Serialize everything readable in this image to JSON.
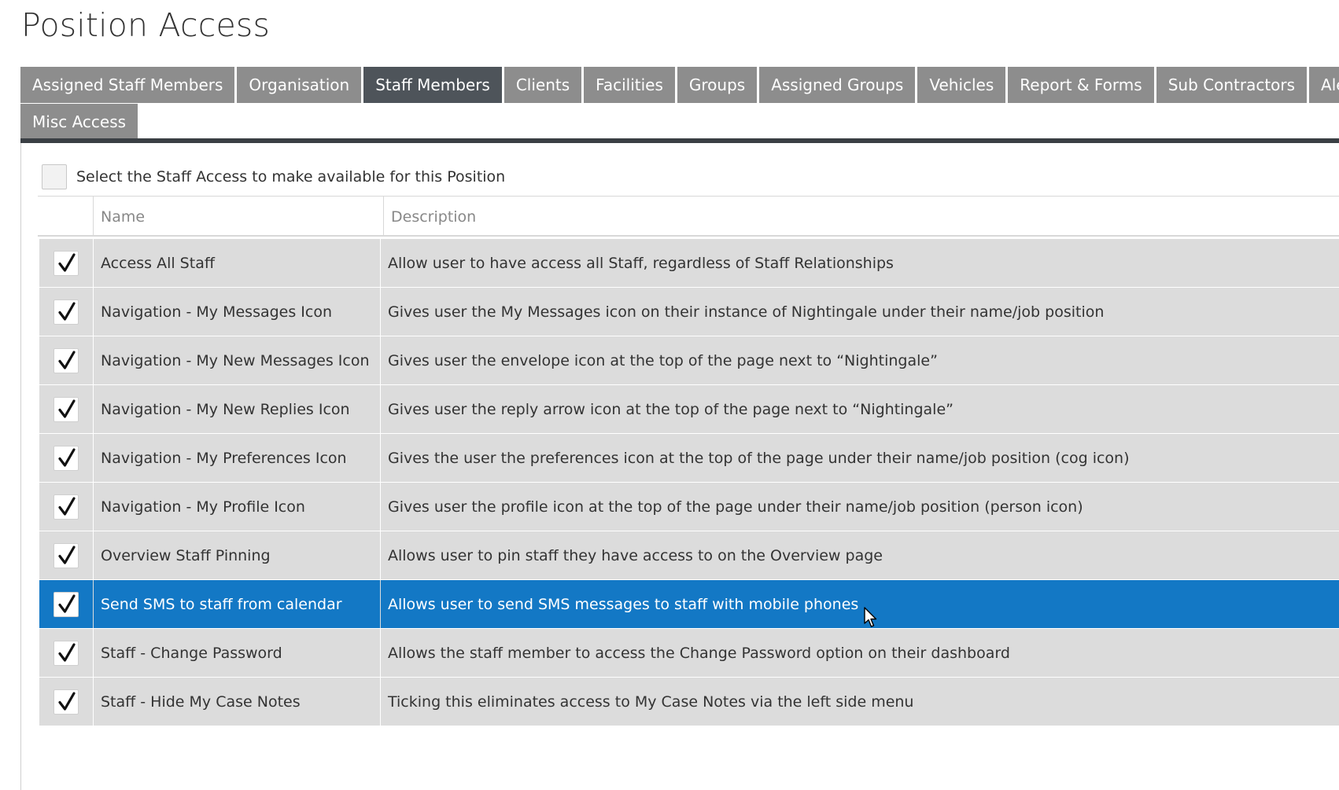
{
  "page": {
    "title": "Position Access"
  },
  "tabs": {
    "row1": [
      {
        "label": "Assigned Staff Members",
        "active": false
      },
      {
        "label": "Organisation",
        "active": false
      },
      {
        "label": "Staff Members",
        "active": true
      },
      {
        "label": "Clients",
        "active": false
      },
      {
        "label": "Facilities",
        "active": false
      },
      {
        "label": "Groups",
        "active": false
      },
      {
        "label": "Assigned Groups",
        "active": false
      },
      {
        "label": "Vehicles",
        "active": false
      },
      {
        "label": "Report & Forms",
        "active": false
      },
      {
        "label": "Sub Contractors",
        "active": false
      },
      {
        "label": "Alerts",
        "active": false
      }
    ],
    "row2": [
      {
        "label": "Misc Access",
        "active": false
      }
    ]
  },
  "select_all": {
    "label": "Select the Staff Access to make available for this Position",
    "checked": false
  },
  "grid": {
    "headers": {
      "check": "",
      "name": "Name",
      "description": "Description"
    },
    "rows": [
      {
        "checked": true,
        "selected": false,
        "name": "Access All Staff",
        "description": "Allow user to have access all Staff, regardless of Staff Relationships"
      },
      {
        "checked": true,
        "selected": false,
        "name": "Navigation - My Messages Icon",
        "description": "Gives user the My Messages icon on their instance of Nightingale under their name/job position"
      },
      {
        "checked": true,
        "selected": false,
        "name": "Navigation - My New Messages Icon",
        "description": "Gives user the envelope icon at the top of the page next to “Nightingale”"
      },
      {
        "checked": true,
        "selected": false,
        "name": "Navigation - My New Replies Icon",
        "description": "Gives user the reply arrow icon at the top of the page next to “Nightingale”"
      },
      {
        "checked": true,
        "selected": false,
        "name": "Navigation - My Preferences Icon",
        "description": "Gives the user the preferences icon at the top of the page under their name/job position (cog icon)"
      },
      {
        "checked": true,
        "selected": false,
        "name": "Navigation - My Profile Icon",
        "description": "Gives user the profile icon at the top of the page under their name/job position (person icon)"
      },
      {
        "checked": true,
        "selected": false,
        "name": "Overview Staff Pinning",
        "description": "Allows user to pin staff they have access to on the Overview page"
      },
      {
        "checked": true,
        "selected": true,
        "name": "Send SMS to staff from calendar",
        "description": "Allows user to send SMS messages to staff with mobile phones"
      },
      {
        "checked": true,
        "selected": false,
        "name": "Staff - Change Password",
        "description": "Allows the staff member to access the Change Password option on their dashboard"
      },
      {
        "checked": true,
        "selected": false,
        "name": "Staff - Hide My Case Notes",
        "description": "Ticking this eliminates access to My Case Notes via the left side menu"
      }
    ]
  },
  "colors": {
    "tab": "#8d8d8d",
    "tab_active": "#4e545a",
    "row": "#dcdcdc",
    "row_selected": "#1378c5"
  },
  "icons": {
    "checkmark": "checkmark-icon",
    "cursor": "mouse-pointer-icon"
  }
}
